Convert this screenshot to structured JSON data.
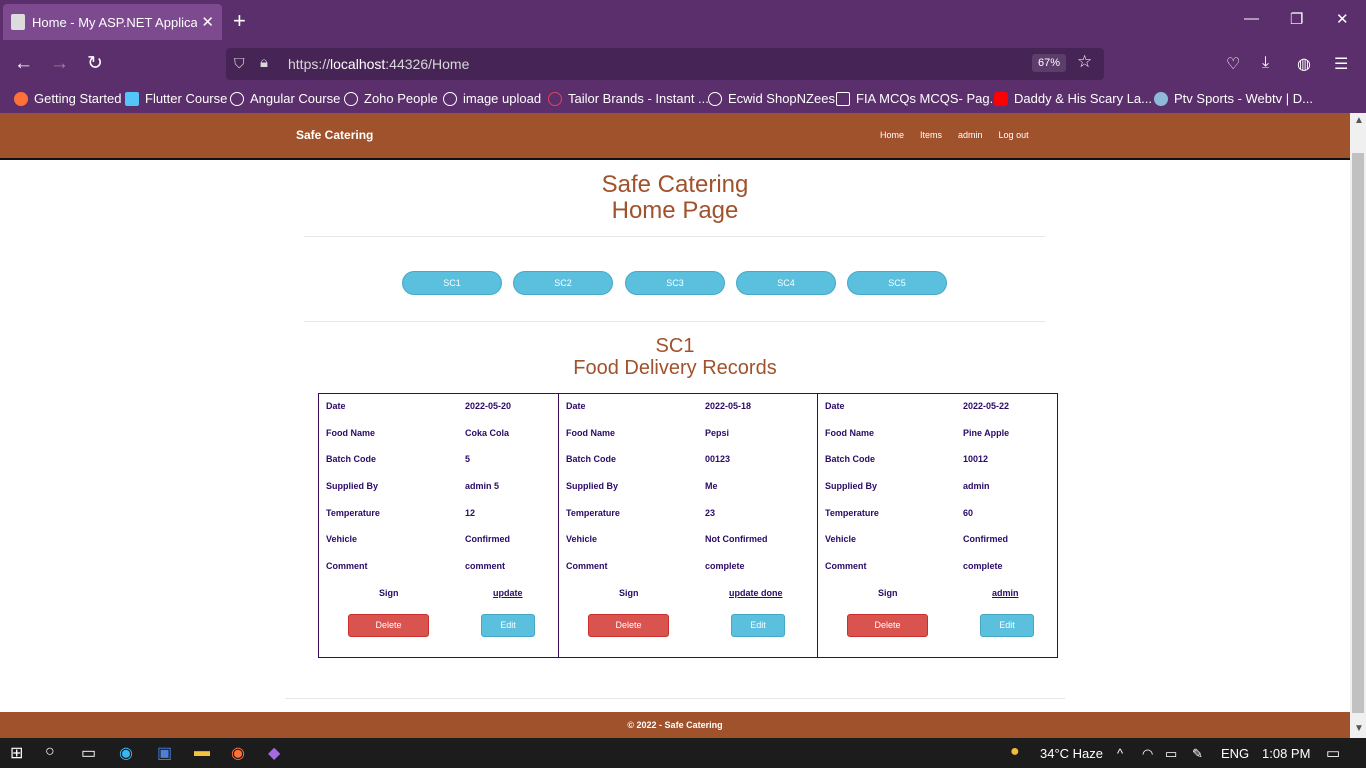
{
  "browser": {
    "tab_title": "Home - My ASP.NET Application",
    "url_prefix": "https://",
    "url_host": "localhost",
    "url_path": ":44326/Home",
    "zoom": "67%",
    "bookmarks": [
      "Getting Started",
      "Flutter Course",
      "Angular Course",
      "Zoho People",
      "image upload",
      "Tailor Brands - Instant ...",
      "Ecwid ShopNZees",
      "FIA MCQs MCQS- Pag...",
      "Daddy & His Scary La...",
      "Ptv Sports - Webtv | D..."
    ]
  },
  "site": {
    "brand": "Safe Catering",
    "nav": [
      "Home",
      "Items",
      "admin",
      "Log out"
    ],
    "title_line1": "Safe Catering",
    "title_line2": "Home Page",
    "sc_buttons": [
      "SC1",
      "SC2",
      "SC3",
      "SC4",
      "SC5"
    ],
    "section_line1": "SC1",
    "section_line2": "Food Delivery Records",
    "field_labels": [
      "Date",
      "Food Name",
      "Batch Code",
      "Supplied By",
      "Temperature",
      "Vehicle",
      "Comment"
    ],
    "sign_label": "Sign",
    "delete_label": "Delete",
    "edit_label": "Edit",
    "records": [
      {
        "values": [
          "2022-05-20",
          "Coka Cola",
          "5",
          "admin 5",
          "12",
          "Confirmed",
          "comment"
        ],
        "sign": "update"
      },
      {
        "values": [
          "2022-05-18",
          "Pepsi",
          "00123",
          "Me",
          "23",
          "Not Confirmed",
          "complete"
        ],
        "sign": "update done"
      },
      {
        "values": [
          "2022-05-22",
          "Pine Apple",
          "10012",
          "admin",
          "60",
          "Confirmed",
          "complete"
        ],
        "sign": "admin"
      }
    ],
    "footer": "© 2022 - Safe Catering"
  },
  "taskbar": {
    "weather": "34°C Haze",
    "lang": "ENG",
    "time": "1:08 PM"
  }
}
